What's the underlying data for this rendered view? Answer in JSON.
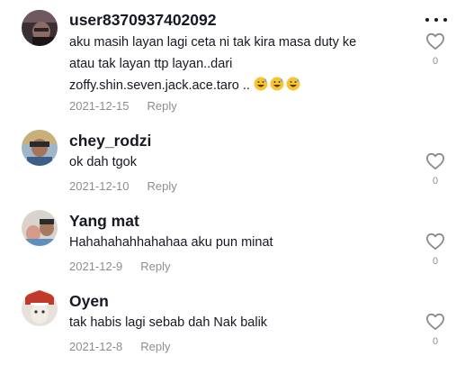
{
  "comments": [
    {
      "username": "user8370937402092",
      "text": "aku masih layan lagi ceta ni tak kira masa duty ke atau tak layan ttp layan..dari zoffy.shin.seven.jack.ace.taro ..",
      "emoji": [
        "grinning-sweat-emoji",
        "grinning-sweat-emoji",
        "grinning-sweat-emoji"
      ],
      "date": "2021-12-15",
      "reply_label": "Reply",
      "likes": "0"
    },
    {
      "username": "chey_rodzi",
      "text": "ok dah tgok",
      "date": "2021-12-10",
      "reply_label": "Reply",
      "likes": "0"
    },
    {
      "username": "Yang mat",
      "text": "Hahahahahhahahaa aku pun minat",
      "date": "2021-12-9",
      "reply_label": "Reply",
      "likes": "0"
    },
    {
      "username": "Oyen",
      "text": "tak habis lagi sebab dah Nak balik",
      "date": "2021-12-8",
      "reply_label": "Reply",
      "likes": "0"
    }
  ],
  "icons": {
    "more": "more-horizontal-icon",
    "like": "heart-outline-icon"
  },
  "colors": {
    "text_primary": "#161823",
    "text_secondary": "#8a8b91",
    "background": "#ffffff"
  }
}
